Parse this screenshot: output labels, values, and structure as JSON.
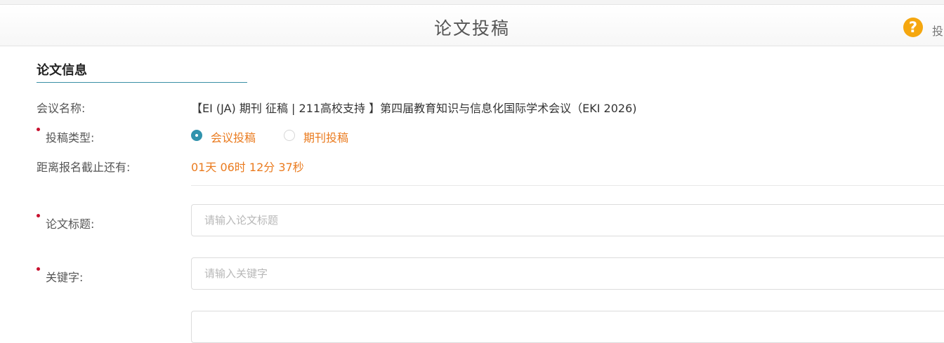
{
  "header": {
    "title": "论文投稿",
    "help_icon_text": "?",
    "help_label": "投"
  },
  "section": {
    "title": "论文信息"
  },
  "fields": {
    "conference_label": "会议名称:",
    "conference_value": "【EI (JA) 期刊 征稿 | 211高校支持 】第四届教育知识与信息化国际学术会议（EKI 2026)",
    "type_label": "投稿类型:",
    "type_options": [
      {
        "label": "会议投稿",
        "selected": true
      },
      {
        "label": "期刊投稿",
        "selected": false
      }
    ],
    "deadline_label": "距离报名截止还有:",
    "deadline_value": "01天 06时 12分 37秒",
    "title_label": "论文标题:",
    "title_placeholder": "请输入论文标题",
    "keywords_label": "关键字:",
    "keywords_placeholder": "请输入关键字"
  },
  "colors": {
    "accent": "#3193ad",
    "highlight": "#ea7b1f",
    "required": "#c8102e",
    "help": "#f5a70f"
  }
}
